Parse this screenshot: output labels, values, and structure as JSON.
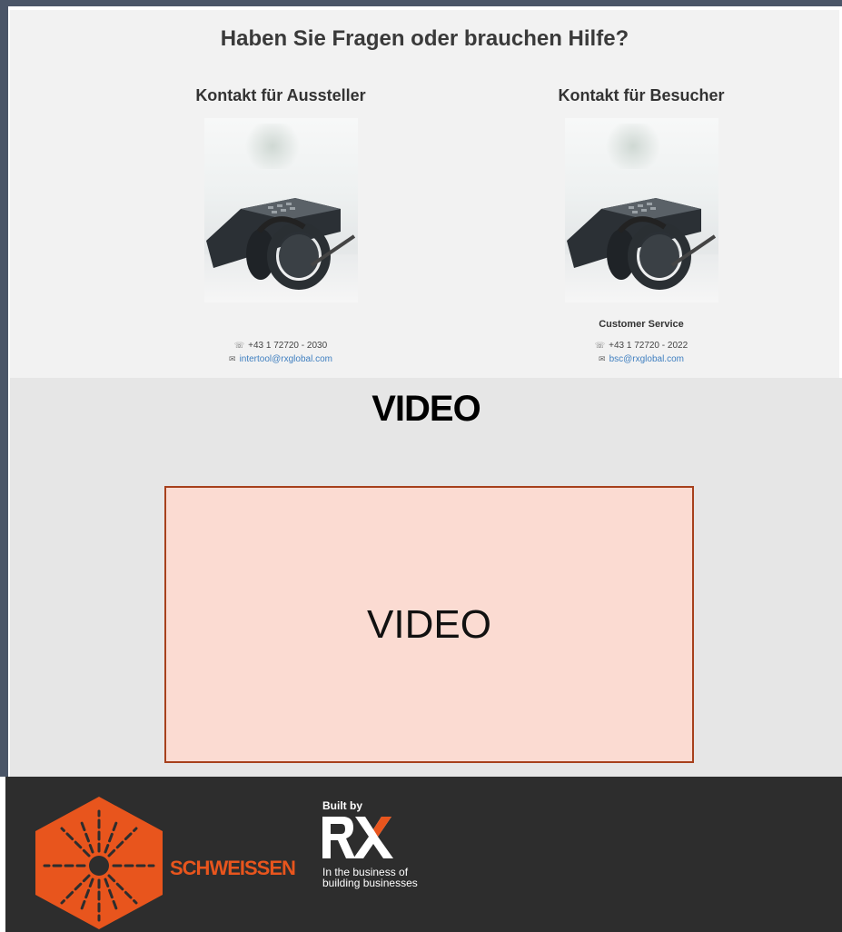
{
  "contact": {
    "title": "Haben Sie Fragen oder brauchen Hilfe?",
    "exhibitors": {
      "heading": "Kontakt für Aussteller",
      "label": "",
      "phone": "+43 1 72720 - 2030",
      "email": "intertool@rxglobal.com"
    },
    "visitors": {
      "heading": "Kontakt für Besucher",
      "label": "Customer Service",
      "phone": "+43 1 72720 - 2022",
      "email": "bsc@rxglobal.com"
    }
  },
  "video": {
    "heading": "VIDEO",
    "placeholder": "VIDEO"
  },
  "footer": {
    "brand": "SCHWEISSEN",
    "built_by": "Built by",
    "rx_logo": "RX",
    "tagline_line1": "In the business of",
    "tagline_line2": "building businesses"
  },
  "icons": {
    "phone": "phone-icon",
    "email": "envelope-icon"
  },
  "colors": {
    "brand_orange": "#e8551d",
    "footer_bg": "#2d2d2d",
    "video_box_bg": "#fbdbd2",
    "video_box_border": "#a7401c",
    "link_blue": "#3f7fc0"
  }
}
